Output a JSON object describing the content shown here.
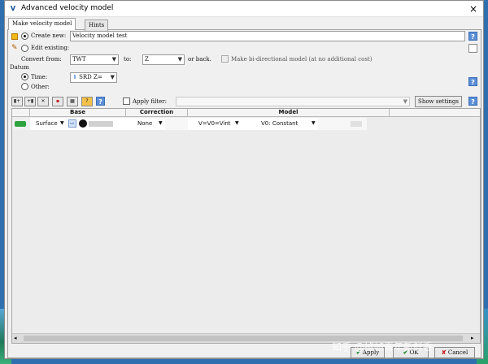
{
  "window": {
    "title": "Advanced velocity model",
    "close_icon": "×",
    "app_icon_label": "V"
  },
  "tabs": [
    {
      "label": "Make velocity model"
    },
    {
      "label": "Hints"
    }
  ],
  "form": {
    "create_new_label": "Create new:",
    "create_new_value": "Velocity model test",
    "edit_existing_label": "Edit existing:",
    "convert_from_label": "Convert from:",
    "convert_from_value": "TWT",
    "to_label": "to:",
    "to_value": "Z",
    "or_back_label": "or back.",
    "bidirectional_label": "Make bi-directional model (at no additional cost)",
    "datum_label": "Datum",
    "time_label": "Time:",
    "time_value": "SRD Z=",
    "other_label": "Other:"
  },
  "toolbar": {
    "apply_filter_label": "Apply filter:",
    "show_settings_label": "Show settings"
  },
  "table": {
    "headers": {
      "base": "Base",
      "correction": "Correction",
      "model": "Model"
    },
    "row": {
      "base_type": "Surface",
      "correction": "None",
      "model_formula": "V=V0=Vint",
      "model_v0": "V0: Constant"
    }
  },
  "buttons": {
    "apply": "Apply",
    "ok": "OK",
    "cancel": "Cancel"
  },
  "watermark": {
    "text": "知乎 @掉帧青年新鲜香"
  },
  "colors": {
    "help": "#5b8ed6",
    "ok_green": "#1c8a2e",
    "cancel_red": "#cc1f1f"
  }
}
